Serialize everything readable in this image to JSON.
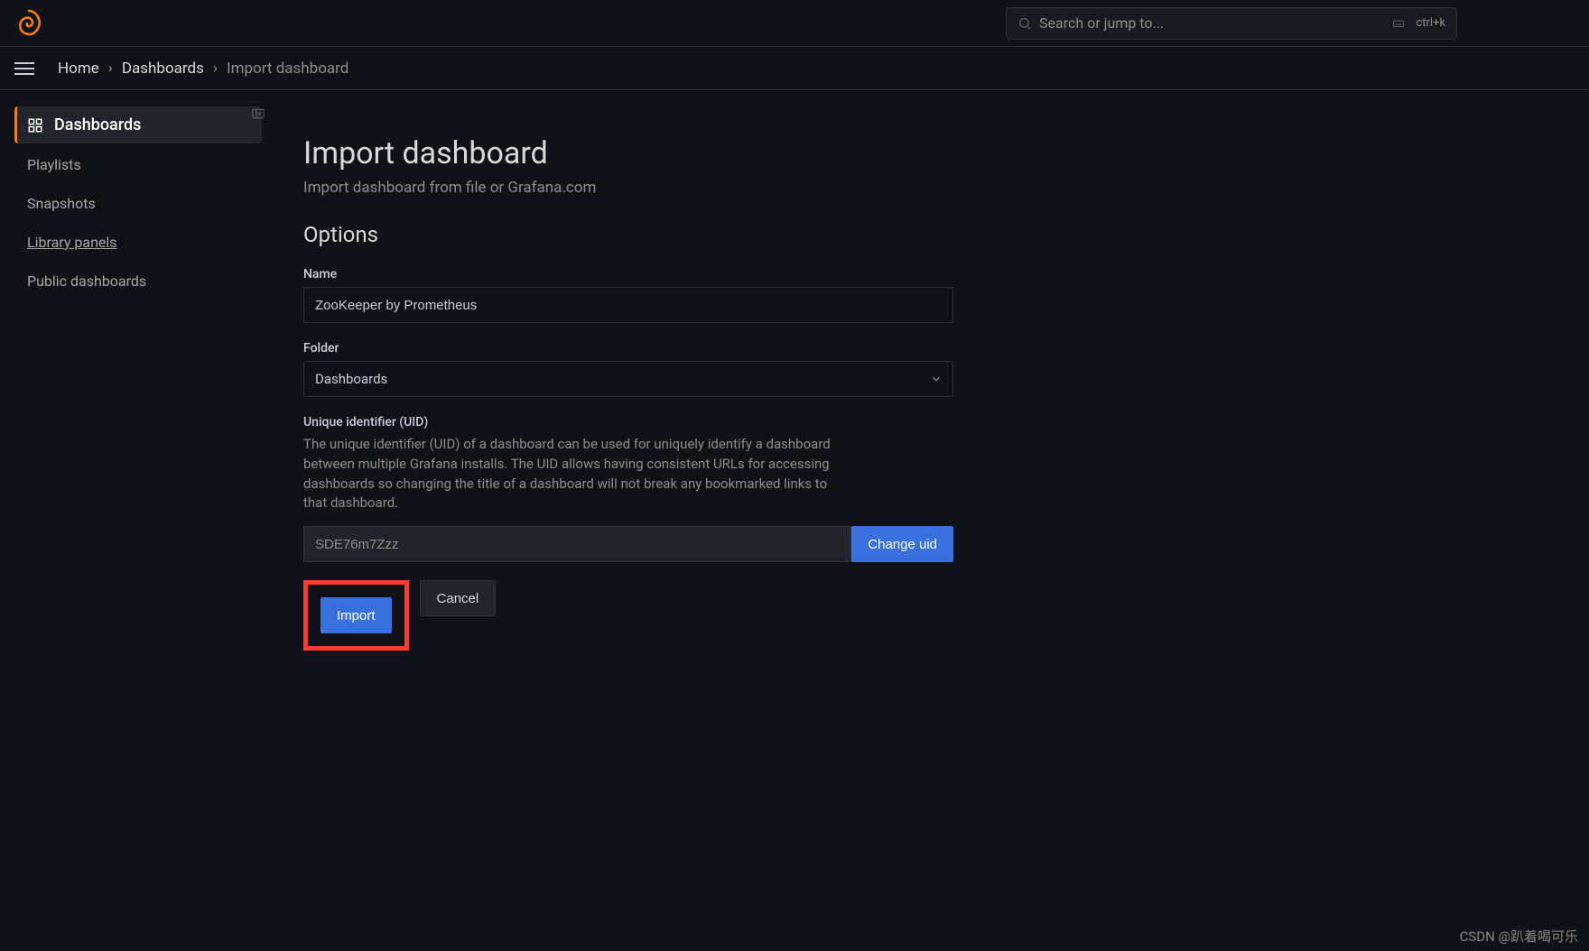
{
  "search": {
    "placeholder": "Search or jump to...",
    "shortcut": "ctrl+k"
  },
  "breadcrumb": {
    "home": "Home",
    "dashboards": "Dashboards",
    "current": "Import dashboard"
  },
  "sidebar": {
    "items": [
      {
        "label": "Dashboards",
        "active": true
      },
      {
        "label": "Playlists"
      },
      {
        "label": "Snapshots"
      },
      {
        "label": "Library panels",
        "underline": true
      },
      {
        "label": "Public dashboards"
      }
    ]
  },
  "main": {
    "title": "Import dashboard",
    "subtitle": "Import dashboard from file or Grafana.com",
    "options_heading": "Options",
    "name_label": "Name",
    "name_value": "ZooKeeper by Prometheus",
    "folder_label": "Folder",
    "folder_value": "Dashboards",
    "uid_label": "Unique identifier (UID)",
    "uid_help": "The unique identifier (UID) of a dashboard can be used for uniquely identify a dashboard between multiple Grafana installs. The UID allows having consistent URLs for accessing dashboards so changing the title of a dashboard will not break any bookmarked links to that dashboard.",
    "uid_value": "SDE76m7Zzz",
    "change_uid": "Change uid",
    "import_btn": "Import",
    "cancel_btn": "Cancel"
  },
  "watermark": "CSDN @趴着喝可乐"
}
